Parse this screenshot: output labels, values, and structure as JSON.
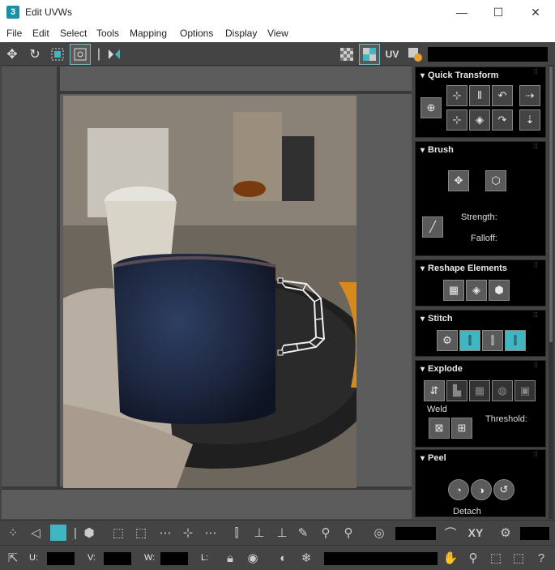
{
  "window": {
    "title": "Edit UVWs",
    "app_icon_text": "3",
    "minimize": "—",
    "maximize": "☐",
    "close": "✕"
  },
  "menu": [
    "File",
    "Edit",
    "Select",
    "Tools",
    "Mapping",
    "Options",
    "Display",
    "View"
  ],
  "toolbar": {
    "uv_label": "UV"
  },
  "panels": {
    "quick_transform": {
      "title": "Quick Transform"
    },
    "brush": {
      "title": "Brush",
      "strength_label": "Strength:",
      "falloff_label": "Falloff:"
    },
    "reshape": {
      "title": "Reshape Elements"
    },
    "stitch": {
      "title": "Stitch"
    },
    "explode": {
      "title": "Explode",
      "weld_label": "Weld",
      "threshold_label": "Threshold:"
    },
    "peel": {
      "title": "Peel",
      "detach_label": "Detach"
    }
  },
  "bottom": {
    "xy_label": "XY",
    "u_label": "U:",
    "v_label": "V:",
    "w_label": "W:",
    "l_label": "L:"
  },
  "colors": {
    "accent": "#3fb6c2",
    "panel": "#000000",
    "bg": "#444444"
  }
}
